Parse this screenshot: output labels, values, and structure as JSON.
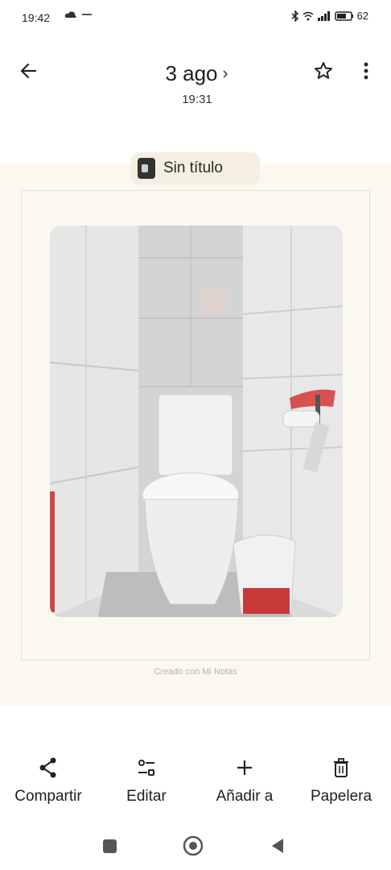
{
  "status_bar": {
    "time": "19:42",
    "battery": "62"
  },
  "header": {
    "date": "3 ago",
    "time": "19:31"
  },
  "album_chip": {
    "label": "Sin título"
  },
  "photo": {
    "caption": "Creado con Mi Notas"
  },
  "actions": [
    {
      "label": "Compartir",
      "icon": "share-icon"
    },
    {
      "label": "Editar",
      "icon": "tune-icon"
    },
    {
      "label": "Añadir a",
      "icon": "add-icon"
    },
    {
      "label": "Papelera",
      "icon": "trash-icon"
    }
  ],
  "navigation": {
    "icons": [
      "recents-square-icon",
      "home-circle-icon",
      "back-triangle-icon"
    ]
  }
}
